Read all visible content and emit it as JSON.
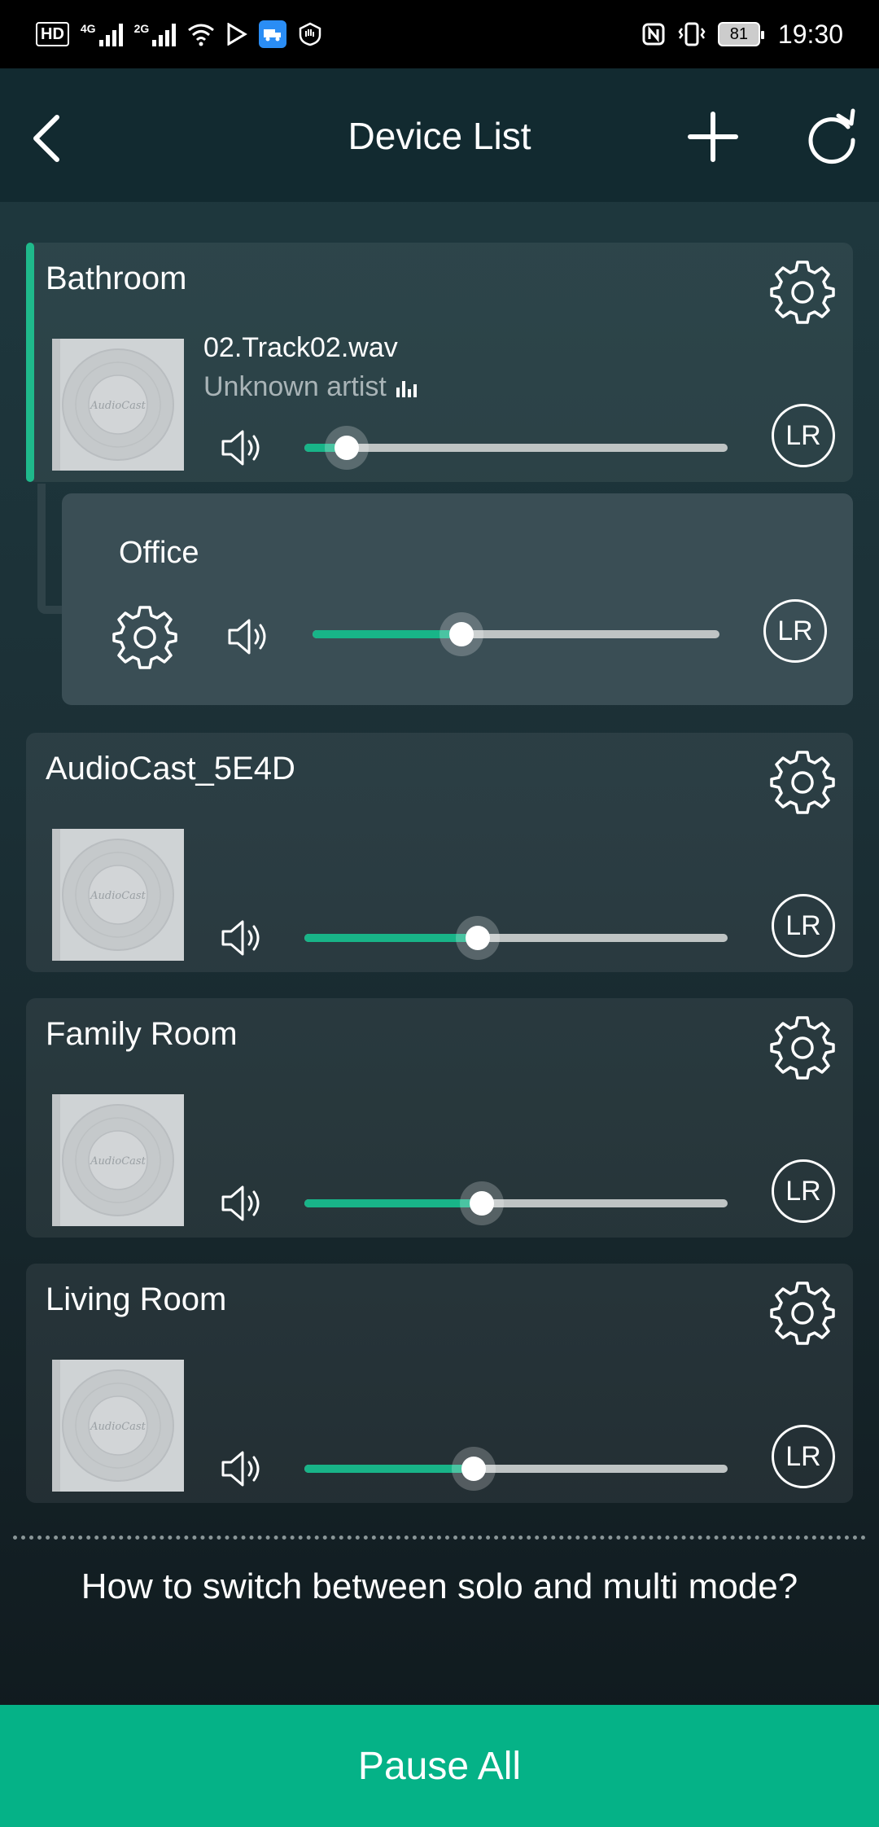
{
  "status_bar": {
    "left_indicators": [
      "HD",
      "4G",
      "2G"
    ],
    "battery": "81",
    "time": "19:30"
  },
  "header": {
    "title": "Device List",
    "icons": {
      "back": "chevron-left-icon",
      "add": "plus-icon",
      "refresh": "refresh-icon"
    }
  },
  "devices": [
    {
      "name": "Bathroom",
      "track_title": "02.Track02.wav",
      "track_artist": "Unknown artist",
      "volume_fraction": 0.1,
      "lr_label": "LR",
      "active": true
    },
    {
      "name": "AudioCast_5E4D",
      "volume_fraction": 0.41,
      "lr_label": "LR"
    },
    {
      "name": "Family Room",
      "volume_fraction": 0.42,
      "lr_label": "LR"
    },
    {
      "name": "Living Room",
      "volume_fraction": 0.4,
      "lr_label": "LR"
    }
  ],
  "grouped_device": {
    "name": "Office",
    "volume_fraction": 0.365,
    "lr_label": "LR"
  },
  "album_art_text": "AudioCast",
  "help_link": "How to switch between solo and multi mode?",
  "pause_all_label": "Pause All",
  "colors": {
    "accent": "#05b287",
    "slider_fill": "#18b488",
    "slider_track": "#bfc4c4",
    "header_bg": "#122a30"
  }
}
